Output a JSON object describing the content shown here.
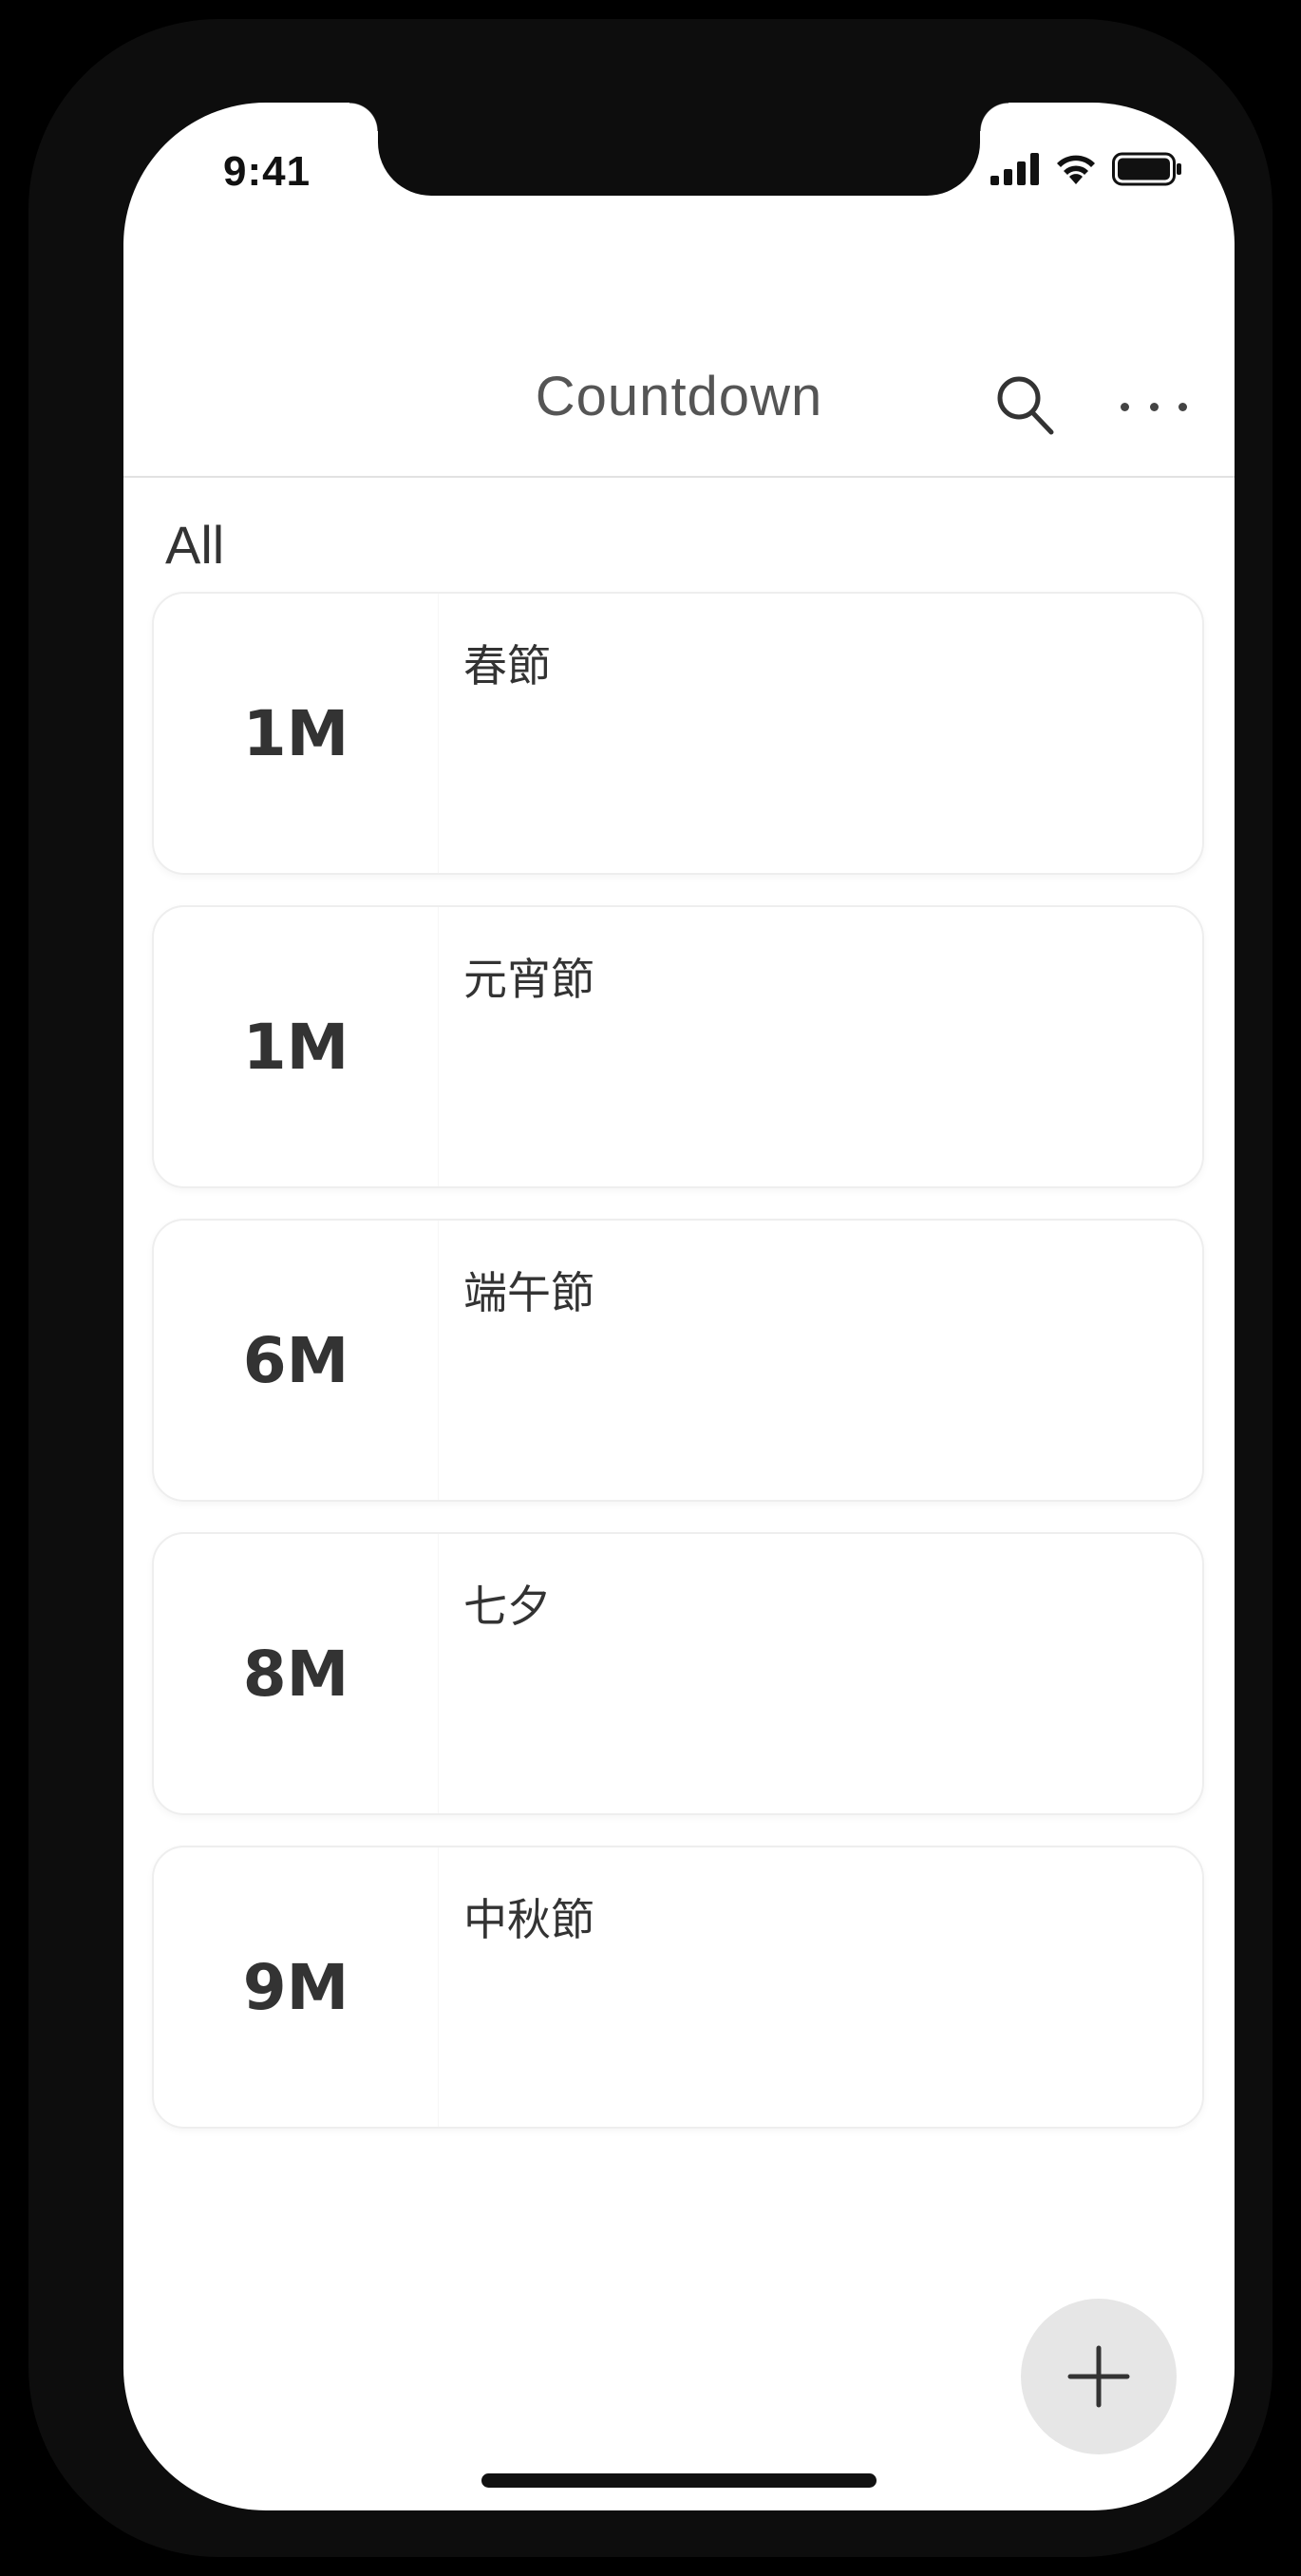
{
  "status_bar": {
    "time": "9:41",
    "icons": [
      "signal-icon",
      "wifi-icon",
      "battery-icon"
    ]
  },
  "nav": {
    "title": "Countdown",
    "actions": [
      "search-icon",
      "more-icon"
    ]
  },
  "section": {
    "title": "All"
  },
  "countdowns": [
    {
      "count": "1M",
      "title": "春節"
    },
    {
      "count": "1M",
      "title": "元宵節"
    },
    {
      "count": "6M",
      "title": "端午節"
    },
    {
      "count": "8M",
      "title": "七夕"
    },
    {
      "count": "9M",
      "title": "中秋節"
    }
  ],
  "fab": {
    "icon": "plus-icon"
  },
  "colors": {
    "background": "#ffffff",
    "text": "#333333",
    "fab": "#e6e6e6",
    "divider": "#e2e2e2"
  }
}
